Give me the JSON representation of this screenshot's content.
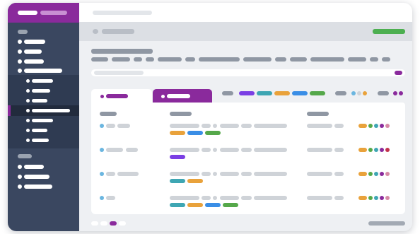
{
  "colors": {
    "brand": "#8a2a9c",
    "sidebar": "#3a4760",
    "sidebar_sub": "#2f3b52",
    "sidebar_active": "#222b3d",
    "success": "#4caf50",
    "purple": "#7b3fe4",
    "teal": "#3ea6b3",
    "orange": "#e9a23b",
    "blue": "#3a8ee6",
    "green": "#55a84a",
    "violet": "#8a2a9c",
    "red": "#c2324c",
    "pink": "#d68aa6",
    "light_blue": "#6bb6e0"
  },
  "sidebar": {
    "main_items": [
      {
        "level": 0
      },
      {
        "level": 0
      },
      {
        "level": 0
      },
      {
        "level": 0
      }
    ],
    "sub_items": [
      {
        "level": 1
      },
      {
        "level": 1
      },
      {
        "level": 1
      },
      {
        "level": 1,
        "active": true
      },
      {
        "level": 1
      },
      {
        "level": 1
      },
      {
        "level": 1
      }
    ],
    "bottom_items": [
      {
        "level": 0
      },
      {
        "level": 0
      },
      {
        "level": 0
      }
    ]
  },
  "table": {
    "columns": [
      "col-1",
      "col-2",
      "col-3"
    ],
    "rows": [
      {
        "tags": [
          "orange",
          "blue",
          "green"
        ],
        "status": [
          "orange",
          "green",
          "teal",
          "violet",
          "pink"
        ]
      },
      {
        "tags": [
          "purple"
        ],
        "status": [
          "orange",
          "green",
          "teal",
          "violet",
          "red"
        ]
      },
      {
        "tags": [
          "teal",
          "orange"
        ],
        "status": [
          "orange",
          "green",
          "teal",
          "violet",
          "pink"
        ]
      },
      {
        "tags": [
          "teal",
          "orange",
          "blue",
          "green"
        ],
        "status": [
          "orange",
          "green",
          "teal",
          "violet",
          "pink"
        ]
      }
    ]
  },
  "filters": [
    "purple",
    "teal",
    "orange",
    "blue",
    "green"
  ],
  "pagination": {
    "pages": 4,
    "current": 3
  }
}
